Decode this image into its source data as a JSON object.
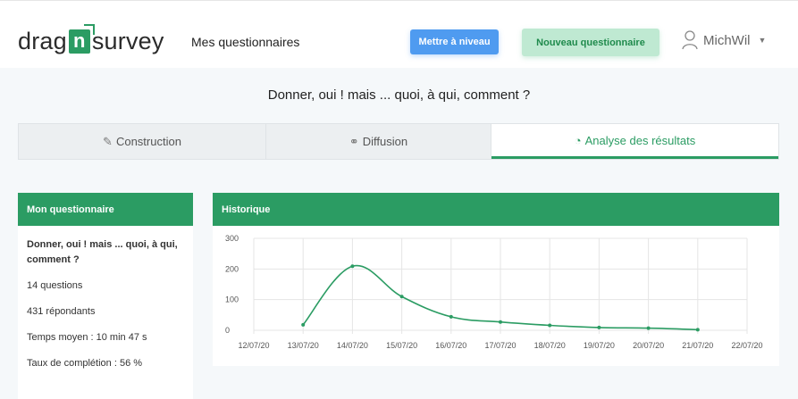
{
  "header": {
    "logo_left": "drag",
    "logo_n": "n",
    "logo_right": "survey",
    "nav": "Mes questionnaires",
    "upgrade": "Mettre à niveau",
    "new_survey": "Nouveau questionnaire",
    "user": "MichWil"
  },
  "survey_title": "Donner, oui ! mais ... quoi, à qui, comment ?",
  "tabs": [
    {
      "label": "Construction",
      "icon": "edit-icon"
    },
    {
      "label": "Diffusion",
      "icon": "share-icon"
    },
    {
      "label": "Analyse des résultats",
      "icon": "pie-chart-icon",
      "active": true
    }
  ],
  "sidebar": {
    "title": "Mon questionnaire",
    "survey_name": "Donner, oui ! mais ... quoi, à qui, comment ?",
    "questions": "14 questions",
    "respondents": "431 répondants",
    "avg_time": "Temps moyen : 10 min 47 s",
    "completion": "Taux de complétion : 56 %"
  },
  "history": {
    "title": "Historique"
  },
  "colors": {
    "brand_green": "#2b9c63",
    "upgrade_blue": "#4f9bf0",
    "light_green": "#bfe9d2"
  },
  "chart_data": {
    "type": "line",
    "title": "Historique",
    "categories": [
      "12/07/20",
      "13/07/20",
      "14/07/20",
      "15/07/20",
      "16/07/20",
      "17/07/20",
      "18/07/20",
      "19/07/20",
      "20/07/20",
      "21/07/20",
      "22/07/20"
    ],
    "series": [
      {
        "values": [
          null,
          18,
          209,
          110,
          44,
          27,
          16,
          9,
          7,
          2,
          null
        ]
      }
    ],
    "ylim": [
      0,
      300
    ],
    "yticks": [
      0,
      100,
      200,
      300
    ],
    "grid": true,
    "color": "#2b9c63"
  }
}
